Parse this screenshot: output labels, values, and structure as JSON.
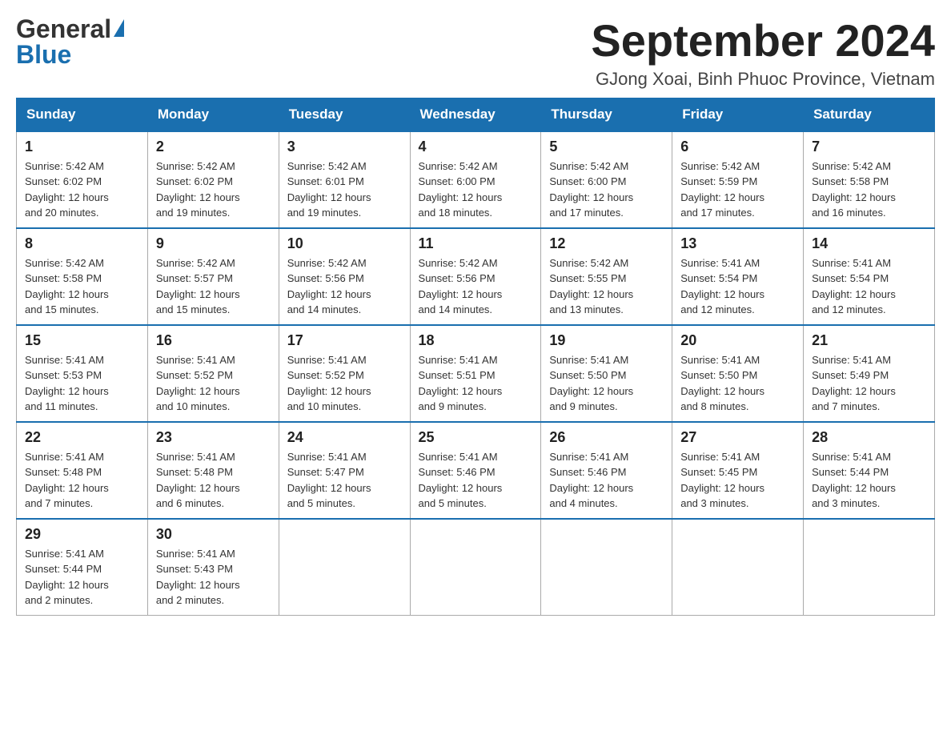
{
  "logo": {
    "general": "General",
    "blue": "Blue"
  },
  "header": {
    "title": "September 2024",
    "location": "GJong Xoai, Binh Phuoc Province, Vietnam"
  },
  "weekdays": [
    "Sunday",
    "Monday",
    "Tuesday",
    "Wednesday",
    "Thursday",
    "Friday",
    "Saturday"
  ],
  "weeks": [
    [
      {
        "day": "1",
        "sunrise": "5:42 AM",
        "sunset": "6:02 PM",
        "daylight": "12 hours and 20 minutes."
      },
      {
        "day": "2",
        "sunrise": "5:42 AM",
        "sunset": "6:02 PM",
        "daylight": "12 hours and 19 minutes."
      },
      {
        "day": "3",
        "sunrise": "5:42 AM",
        "sunset": "6:01 PM",
        "daylight": "12 hours and 19 minutes."
      },
      {
        "day": "4",
        "sunrise": "5:42 AM",
        "sunset": "6:00 PM",
        "daylight": "12 hours and 18 minutes."
      },
      {
        "day": "5",
        "sunrise": "5:42 AM",
        "sunset": "6:00 PM",
        "daylight": "12 hours and 17 minutes."
      },
      {
        "day": "6",
        "sunrise": "5:42 AM",
        "sunset": "5:59 PM",
        "daylight": "12 hours and 17 minutes."
      },
      {
        "day": "7",
        "sunrise": "5:42 AM",
        "sunset": "5:58 PM",
        "daylight": "12 hours and 16 minutes."
      }
    ],
    [
      {
        "day": "8",
        "sunrise": "5:42 AM",
        "sunset": "5:58 PM",
        "daylight": "12 hours and 15 minutes."
      },
      {
        "day": "9",
        "sunrise": "5:42 AM",
        "sunset": "5:57 PM",
        "daylight": "12 hours and 15 minutes."
      },
      {
        "day": "10",
        "sunrise": "5:42 AM",
        "sunset": "5:56 PM",
        "daylight": "12 hours and 14 minutes."
      },
      {
        "day": "11",
        "sunrise": "5:42 AM",
        "sunset": "5:56 PM",
        "daylight": "12 hours and 14 minutes."
      },
      {
        "day": "12",
        "sunrise": "5:42 AM",
        "sunset": "5:55 PM",
        "daylight": "12 hours and 13 minutes."
      },
      {
        "day": "13",
        "sunrise": "5:41 AM",
        "sunset": "5:54 PM",
        "daylight": "12 hours and 12 minutes."
      },
      {
        "day": "14",
        "sunrise": "5:41 AM",
        "sunset": "5:54 PM",
        "daylight": "12 hours and 12 minutes."
      }
    ],
    [
      {
        "day": "15",
        "sunrise": "5:41 AM",
        "sunset": "5:53 PM",
        "daylight": "12 hours and 11 minutes."
      },
      {
        "day": "16",
        "sunrise": "5:41 AM",
        "sunset": "5:52 PM",
        "daylight": "12 hours and 10 minutes."
      },
      {
        "day": "17",
        "sunrise": "5:41 AM",
        "sunset": "5:52 PM",
        "daylight": "12 hours and 10 minutes."
      },
      {
        "day": "18",
        "sunrise": "5:41 AM",
        "sunset": "5:51 PM",
        "daylight": "12 hours and 9 minutes."
      },
      {
        "day": "19",
        "sunrise": "5:41 AM",
        "sunset": "5:50 PM",
        "daylight": "12 hours and 9 minutes."
      },
      {
        "day": "20",
        "sunrise": "5:41 AM",
        "sunset": "5:50 PM",
        "daylight": "12 hours and 8 minutes."
      },
      {
        "day": "21",
        "sunrise": "5:41 AM",
        "sunset": "5:49 PM",
        "daylight": "12 hours and 7 minutes."
      }
    ],
    [
      {
        "day": "22",
        "sunrise": "5:41 AM",
        "sunset": "5:48 PM",
        "daylight": "12 hours and 7 minutes."
      },
      {
        "day": "23",
        "sunrise": "5:41 AM",
        "sunset": "5:48 PM",
        "daylight": "12 hours and 6 minutes."
      },
      {
        "day": "24",
        "sunrise": "5:41 AM",
        "sunset": "5:47 PM",
        "daylight": "12 hours and 5 minutes."
      },
      {
        "day": "25",
        "sunrise": "5:41 AM",
        "sunset": "5:46 PM",
        "daylight": "12 hours and 5 minutes."
      },
      {
        "day": "26",
        "sunrise": "5:41 AM",
        "sunset": "5:46 PM",
        "daylight": "12 hours and 4 minutes."
      },
      {
        "day": "27",
        "sunrise": "5:41 AM",
        "sunset": "5:45 PM",
        "daylight": "12 hours and 3 minutes."
      },
      {
        "day": "28",
        "sunrise": "5:41 AM",
        "sunset": "5:44 PM",
        "daylight": "12 hours and 3 minutes."
      }
    ],
    [
      {
        "day": "29",
        "sunrise": "5:41 AM",
        "sunset": "5:44 PM",
        "daylight": "12 hours and 2 minutes."
      },
      {
        "day": "30",
        "sunrise": "5:41 AM",
        "sunset": "5:43 PM",
        "daylight": "12 hours and 2 minutes."
      },
      null,
      null,
      null,
      null,
      null
    ]
  ],
  "labels": {
    "sunrise": "Sunrise:",
    "sunset": "Sunset:",
    "daylight": "Daylight:"
  }
}
